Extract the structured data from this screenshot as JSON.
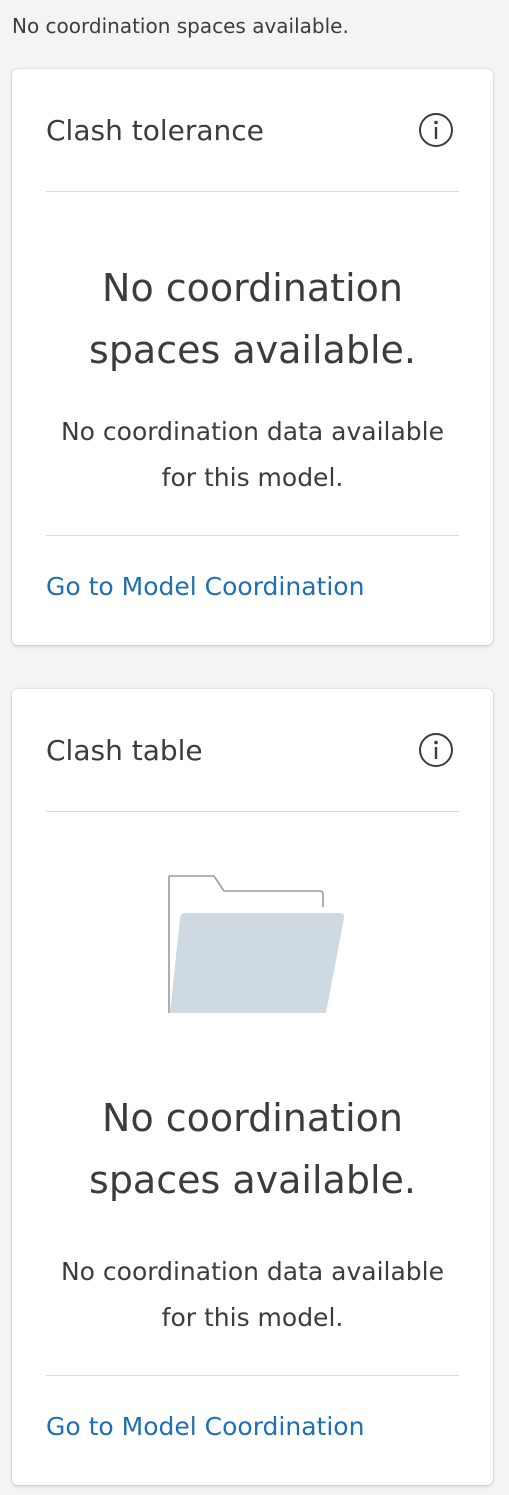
{
  "status_text": "No coordination spaces available.",
  "colors": {
    "background": "#f4f4f4",
    "card": "#ffffff",
    "text": "#3c3c3c",
    "link": "#1f6fb5",
    "divider": "#d8d8d8",
    "folder_fill": "#cfd9e2"
  },
  "cards": [
    {
      "title": "Clash tolerance",
      "info_icon": "info-icon",
      "empty_title": "No coordination spaces available.",
      "empty_description": "No coordination data available for this model.",
      "link_label": "Go to Model Coordination"
    },
    {
      "title": "Clash table",
      "info_icon": "info-icon",
      "illustration": "folder-icon",
      "empty_title": "No coordination spaces available.",
      "empty_description": "No coordination data available for this model.",
      "link_label": "Go to Model Coordination"
    }
  ]
}
